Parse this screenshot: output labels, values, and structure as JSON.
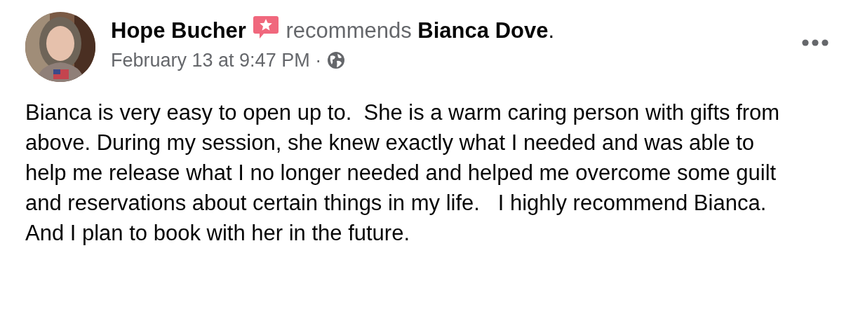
{
  "post": {
    "author": "Hope Bucher",
    "action": "recommends",
    "page": "Bianca Dove",
    "page_suffix": ".",
    "timestamp": "February 13 at 9:47 PM",
    "separator": "·",
    "text": "Bianca is very easy to open up to.  She is a warm caring person with gifts from above. During my session, she knew exactly what I needed and was able to help me release what I no longer needed and helped me overcome some guilt and reservations about certain things in my life.   I highly recommend Bianca.  And I plan to book with her in the future."
  }
}
